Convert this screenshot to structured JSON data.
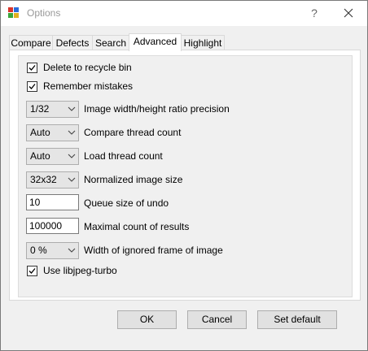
{
  "window": {
    "title": "Options",
    "help": "?",
    "close": "×"
  },
  "tabs": [
    {
      "label": "Compare",
      "active": false
    },
    {
      "label": "Defects",
      "active": false
    },
    {
      "label": "Search",
      "active": false
    },
    {
      "label": "Advanced",
      "active": true
    },
    {
      "label": "Highlight",
      "active": false
    }
  ],
  "checkboxes": {
    "delete_to_recycle_bin": {
      "label": "Delete to recycle bin",
      "checked": true
    },
    "remember_mistakes": {
      "label": "Remember mistakes",
      "checked": true
    },
    "use_libjpeg_turbo": {
      "label": "Use libjpeg-turbo",
      "checked": true
    }
  },
  "fields": {
    "ratio_precision": {
      "value": "1/32",
      "label": "Image width/height ratio precision"
    },
    "compare_threads": {
      "value": "Auto",
      "label": "Compare thread count"
    },
    "load_threads": {
      "value": "Auto",
      "label": "Load thread count"
    },
    "normalized_size": {
      "value": "32x32",
      "label": "Normalized image size"
    },
    "undo_queue": {
      "value": "10",
      "label": "Queue size of undo"
    },
    "max_results": {
      "value": "100000",
      "label": "Maximal count of results"
    },
    "ignored_frame": {
      "value": "0 %",
      "label": "Width of ignored frame of image"
    }
  },
  "buttons": {
    "ok": "OK",
    "cancel": "Cancel",
    "set_default": "Set default"
  }
}
